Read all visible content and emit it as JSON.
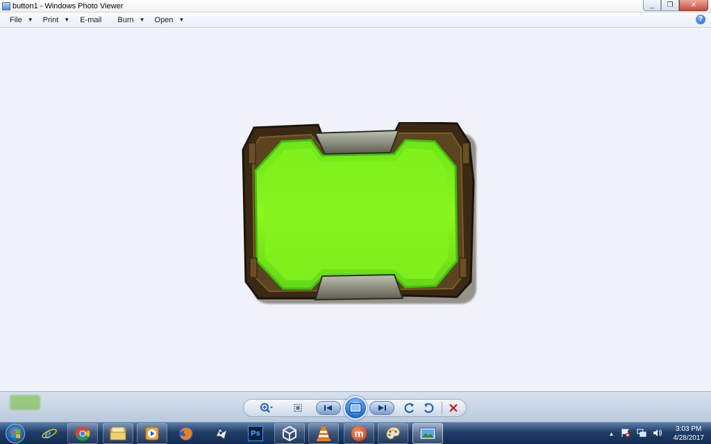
{
  "window": {
    "title": "button1 - Windows Photo Viewer",
    "controls": {
      "minimize": "_",
      "maximize": "❐",
      "close": "✕"
    }
  },
  "menu": {
    "items": [
      {
        "label": "File",
        "has_caret": true
      },
      {
        "label": "Print",
        "has_caret": true
      },
      {
        "label": "E-mail",
        "has_caret": false
      },
      {
        "label": "Burn",
        "has_caret": true
      },
      {
        "label": "Open",
        "has_caret": true
      }
    ],
    "help": "?"
  },
  "image": {
    "description_icon": "green-button-image",
    "colors": {
      "frame": "#3b2a16",
      "frame_edge": "#6b4a1e",
      "glass": "#7ef51a",
      "glass_edge": "#3fbf0c",
      "clip": "#8c8f7e"
    }
  },
  "controls": {
    "zoom_icon": "zoom-icon",
    "actual_size_icon": "actual-size-icon",
    "previous_icon": "previous-icon",
    "slideshow_icon": "slideshow-icon",
    "next_icon": "next-icon",
    "rotate_ccw_icon": "rotate-counterclockwise-icon",
    "rotate_cw_icon": "rotate-clockwise-icon",
    "delete_icon": "delete-icon",
    "accent": "#1c6bd1",
    "delete_color": "#d0241b"
  },
  "taskbar": {
    "apps": [
      {
        "name": "internet-explorer-icon"
      },
      {
        "name": "chrome-icon"
      },
      {
        "name": "file-explorer-icon"
      },
      {
        "name": "media-player-icon"
      },
      {
        "name": "firefox-icon"
      },
      {
        "name": "jetbrains-icon"
      },
      {
        "name": "photoshop-icon",
        "text": "Ps"
      },
      {
        "name": "unity-icon"
      },
      {
        "name": "vlc-icon"
      },
      {
        "name": "app-m-icon",
        "text": "m"
      },
      {
        "name": "paint-icon"
      },
      {
        "name": "photo-viewer-icon"
      }
    ],
    "tray": {
      "show_hidden": "▲",
      "clock_time": "3:03 PM",
      "clock_date": "4/28/2017"
    }
  }
}
